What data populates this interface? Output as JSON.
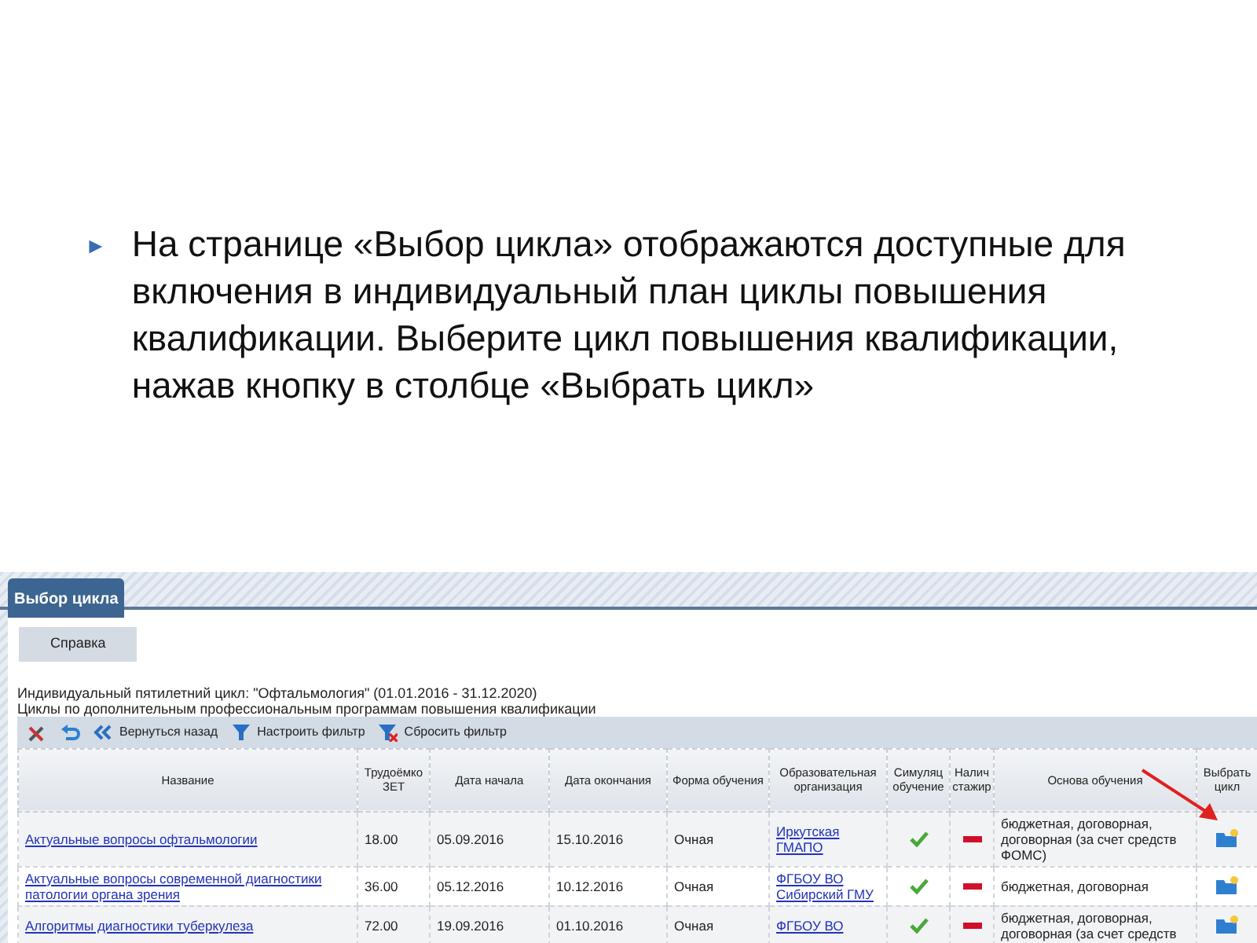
{
  "slide": {
    "bullet": "►",
    "text": "На странице «Выбор цикла» отображаются доступные для включения в индивидуальный план циклы повышения квалификации. Выберите цикл повышения квалификации, нажав кнопку в столбце «Выбрать цикл»"
  },
  "screenshot": {
    "tab": "Выбор цикла",
    "help_button": "Справка",
    "info_lines": [
      "Индивидуальный пятилетний цикл: \"Офтальмология\" (01.01.2016 - 31.12.2020)",
      "Циклы по дополнительным профессиональным программам повышения квалификации"
    ],
    "toolbar": [
      {
        "kind": "tools"
      },
      {
        "kind": "refresh"
      },
      {
        "kind": "back",
        "label": "Вернуться назад"
      },
      {
        "kind": "filter",
        "label": "Настроить фильтр"
      },
      {
        "kind": "reset",
        "label": "Сбросить фильтр"
      }
    ],
    "table": {
      "columns": [
        "Название",
        "Трудоёмко ЗЕТ",
        "Дата начала",
        "Дата окончания",
        "Форма обучения",
        "Образовательная организация",
        "Симуляц обучение",
        "Налич стажир",
        "Основа обучения",
        "Выбрать цикл"
      ],
      "rows": [
        {
          "name": "Актуальные вопросы офтальмологии",
          "credits": "18.00",
          "start": "05.09.2016",
          "end": "15.10.2016",
          "form": "Очная",
          "org": "Иркутская ГМАПО",
          "simulation": true,
          "internship": false,
          "basis": "бюджетная, договорная, договорная (за счет средств ФОМС)"
        },
        {
          "name": "Актуальные вопросы современной диагностики патологии органа зрения",
          "credits": "36.00",
          "start": "05.12.2016",
          "end": "10.12.2016",
          "form": "Очная",
          "org": "ФГБОУ ВО Сибирский ГМУ",
          "simulation": true,
          "internship": false,
          "basis": "бюджетная, договорная"
        },
        {
          "name": "Алгоритмы диагностики туберкулеза",
          "credits": "72.00",
          "start": "19.09.2016",
          "end": "01.10.2016",
          "form": "Очная",
          "org": "ФГБОУ ВО",
          "simulation": true,
          "internship": false,
          "basis": "бюджетная, договорная, договорная (за счет средств"
        }
      ]
    }
  }
}
